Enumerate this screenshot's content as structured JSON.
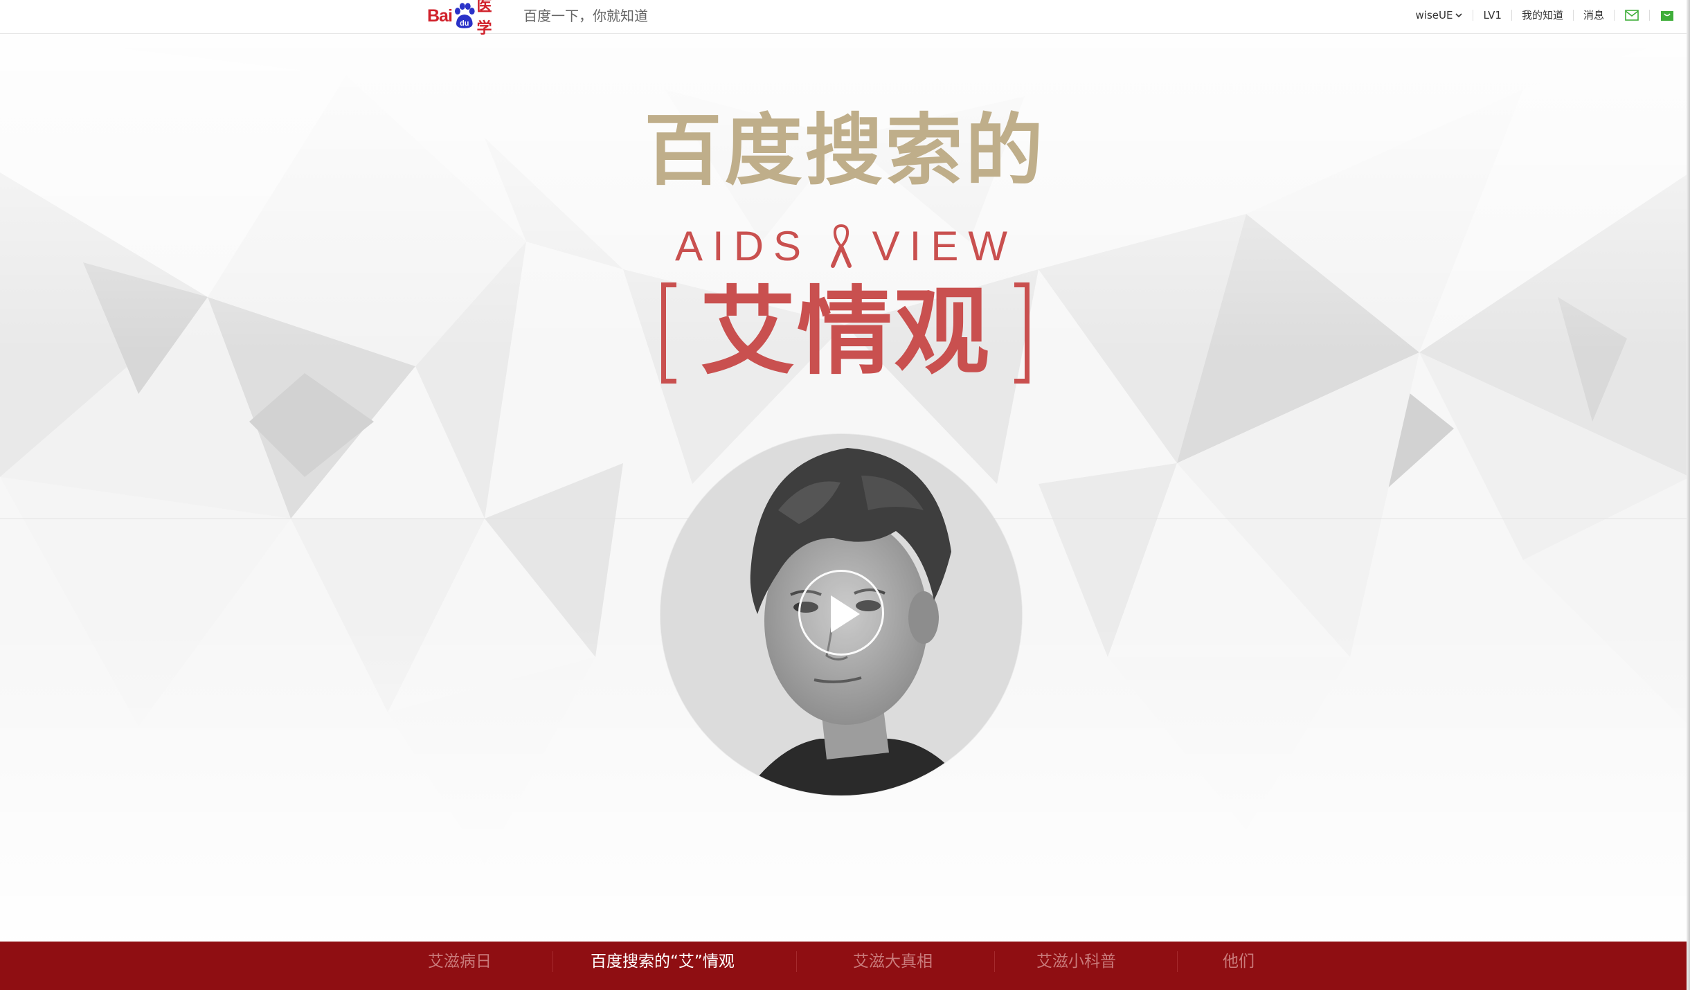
{
  "header": {
    "logo_bai": "Bai",
    "logo_du": "du",
    "logo_yixue": "医学",
    "slogan": "百度一下，你就知道",
    "user": "wiseUE",
    "level": "LV1",
    "my_zhidao": "我的知道",
    "messages": "消息",
    "icons": [
      "chevron-down-icon",
      "mail-icon",
      "shopping-bag-icon"
    ],
    "accent_green": "#3fae3a"
  },
  "hero": {
    "title_cn": "百度搜索的",
    "title_en_left": "AIDS",
    "title_en_right": "VIEW",
    "title_main": "艾情观",
    "colors": {
      "gold": "#bfae8a",
      "red": "#c9504f"
    },
    "video_icon": "play-icon"
  },
  "bottom_nav": {
    "background": "#8f0e12",
    "tabs": [
      {
        "label": "艾滋病日",
        "active": false
      },
      {
        "label": "百度搜索的“艾”情观",
        "active": true
      },
      {
        "label": "艾滋大真相",
        "active": false
      },
      {
        "label": "艾滋小科普",
        "active": false
      },
      {
        "label": "他们",
        "active": false
      }
    ]
  }
}
